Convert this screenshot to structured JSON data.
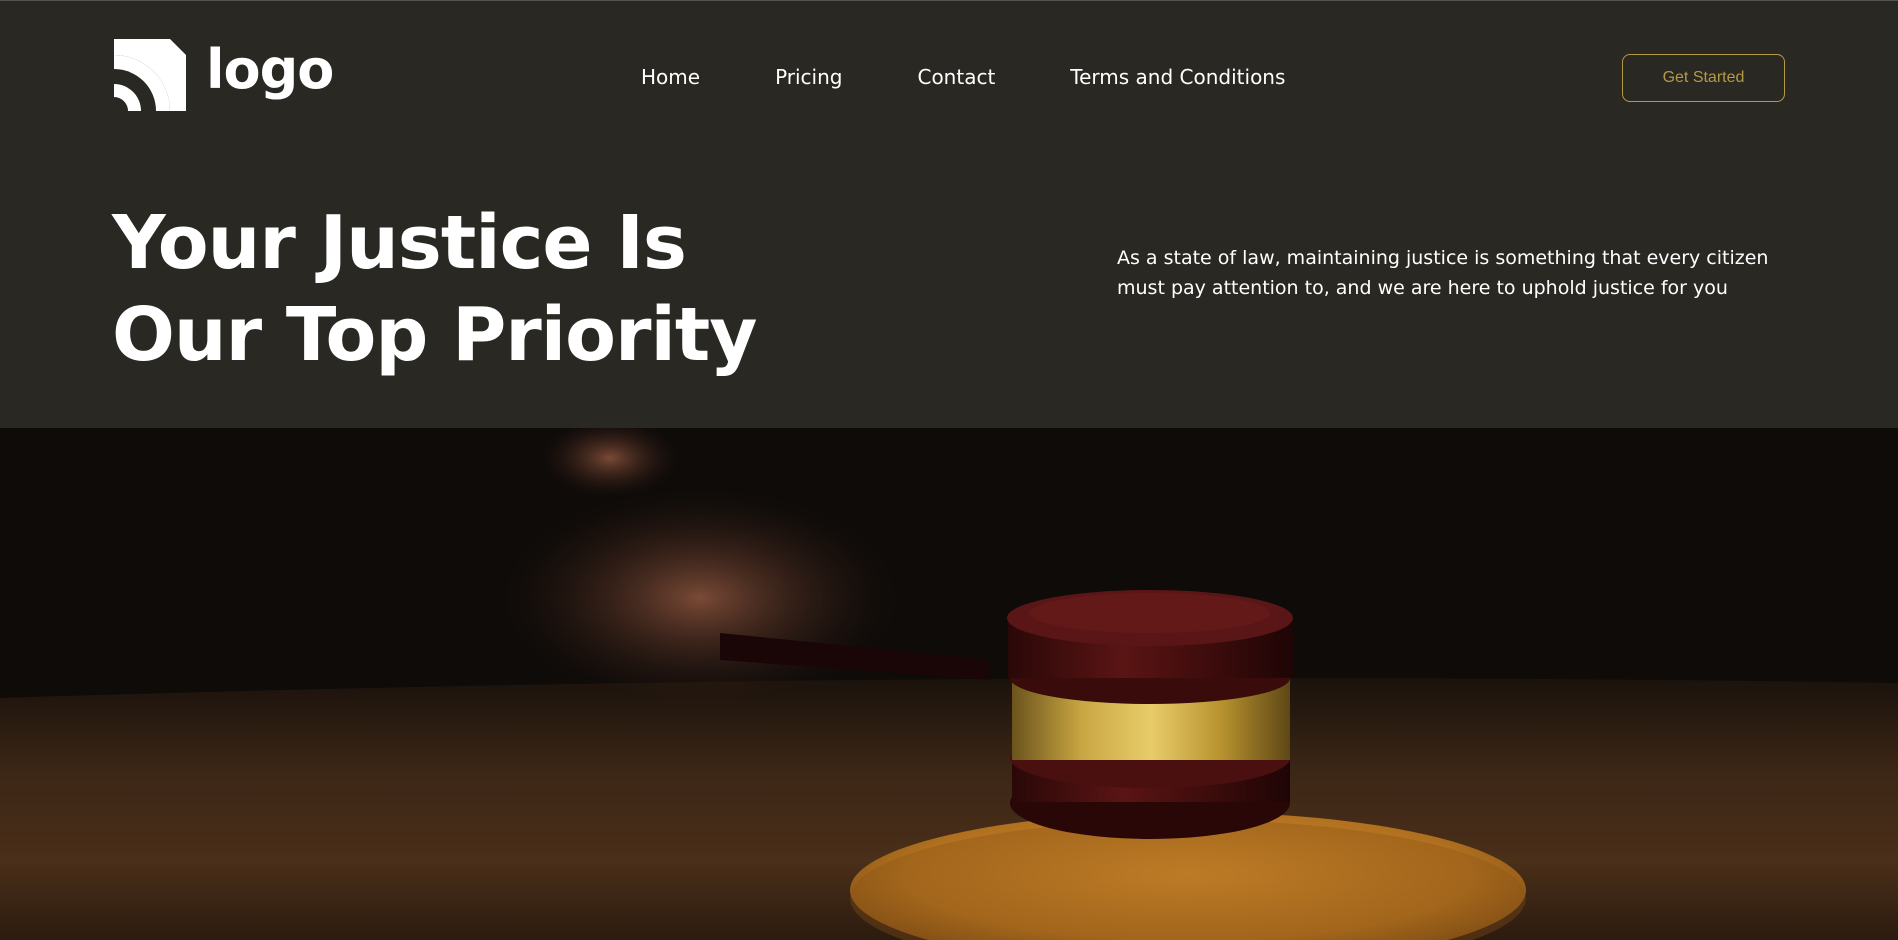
{
  "brand": {
    "logo_text": "logo",
    "logo_icon": "signal-arcs-icon"
  },
  "nav": {
    "items": [
      {
        "label": "Home"
      },
      {
        "label": "Pricing"
      },
      {
        "label": "Contact"
      },
      {
        "label": "Terms and Conditions"
      }
    ]
  },
  "cta": {
    "label": "Get Started"
  },
  "hero": {
    "headline_line1": "Your Justice Is",
    "headline_line2": "Our Top Priority",
    "intro": "As a state of law, maintaining justice is something that every citizen must pay attention to, and we are here to uphold justice for you"
  },
  "colors": {
    "background": "#2a2822",
    "accent": "#b59a44",
    "text": "#ffffff"
  }
}
